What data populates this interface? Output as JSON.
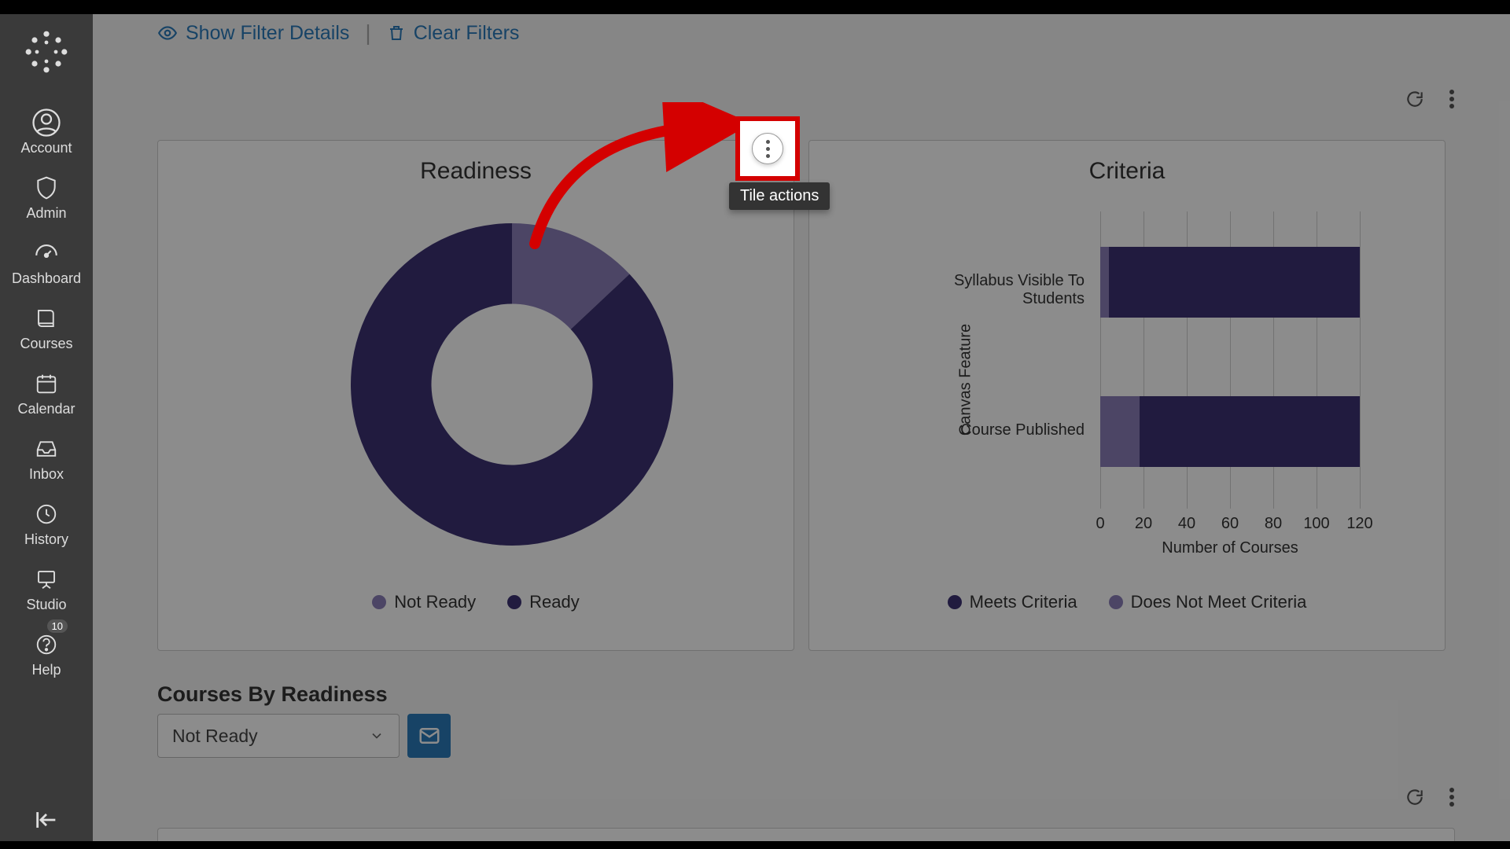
{
  "colors": {
    "dark_purple": "#3c3274",
    "light_purple": "#8a7fb8",
    "link_blue": "#2b7abb",
    "highlight_red": "#d40000"
  },
  "sidebar": {
    "items": [
      {
        "label": "Account"
      },
      {
        "label": "Admin"
      },
      {
        "label": "Dashboard"
      },
      {
        "label": "Courses"
      },
      {
        "label": "Calendar"
      },
      {
        "label": "Inbox"
      },
      {
        "label": "History"
      },
      {
        "label": "Studio"
      },
      {
        "label": "Help",
        "badge": "10"
      }
    ]
  },
  "filter_bar": {
    "show_details": "Show Filter Details",
    "clear": "Clear Filters"
  },
  "tooltip": {
    "tile_actions": "Tile actions"
  },
  "readiness_card": {
    "title": "Readiness",
    "legend": {
      "not_ready": "Not Ready",
      "ready": "Ready"
    }
  },
  "criteria_card": {
    "title": "Criteria",
    "y_axis": "Canvas Feature",
    "x_axis": "Number of Courses",
    "legend": {
      "meets": "Meets Criteria",
      "not_meets": "Does Not Meet Criteria"
    }
  },
  "chart_data": [
    {
      "type": "pie",
      "title": "Readiness",
      "subtype": "donut",
      "series": [
        {
          "name": "Not Ready",
          "value": 13,
          "color_key": "light_purple"
        },
        {
          "name": "Ready",
          "value": 87,
          "color_key": "dark_purple"
        }
      ]
    },
    {
      "type": "bar",
      "title": "Criteria",
      "orientation": "horizontal",
      "xlabel": "Number of Courses",
      "ylabel": "Canvas Feature",
      "xlim": [
        0,
        120
      ],
      "x_ticks": [
        0,
        20,
        40,
        60,
        80,
        100,
        120
      ],
      "categories": [
        "Syllabus Visible To Students",
        "Course Published"
      ],
      "series": [
        {
          "name": "Does Not Meet Criteria",
          "color_key": "light_purple",
          "values": [
            4,
            18
          ]
        },
        {
          "name": "Meets Criteria",
          "color_key": "dark_purple",
          "values": [
            116,
            102
          ]
        }
      ],
      "stacked": true
    }
  ],
  "courses_section": {
    "title": "Courses By Readiness",
    "dropdown_selected": "Not Ready"
  }
}
